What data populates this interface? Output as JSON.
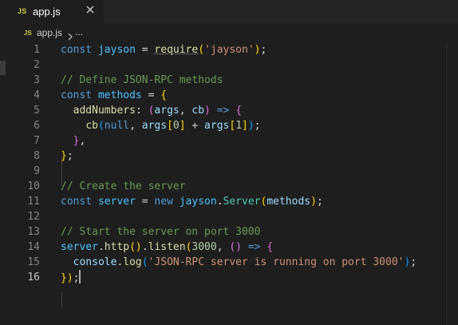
{
  "tab": {
    "badge": "JS",
    "filename": "app.js"
  },
  "breadcrumb": {
    "badge": "JS",
    "file": "app.js",
    "more": "..."
  },
  "editor": {
    "line_numbers": [
      "1",
      "2",
      "3",
      "4",
      "5",
      "6",
      "7",
      "8",
      "9",
      "10",
      "11",
      "12",
      "13",
      "14",
      "15",
      "16"
    ],
    "active_line": 16,
    "lines": [
      "const jayson = require('jayson');",
      "",
      "// Define JSON-RPC methods",
      "const methods = {",
      "  addNumbers: (args, cb) => {",
      "    cb(null, args[0] + args[1]);",
      "  },",
      "};",
      "",
      "// Create the server",
      "const server = new jayson.Server(methods);",
      "",
      "// Start the server on port 3000",
      "server.http().listen(3000, () => {",
      "  console.log('JSON-RPC server is running on port 3000');",
      "});"
    ]
  },
  "colors": {
    "background": "#1e1e1e",
    "keyword": "#569cd6",
    "variable": "#4fc1ff",
    "function": "#dcdcaa",
    "string": "#ce9178",
    "comment": "#6a9955",
    "class": "#4ec9b0"
  },
  "icons": [
    "js-file-icon",
    "close-icon",
    "chevron-right-icon"
  ]
}
